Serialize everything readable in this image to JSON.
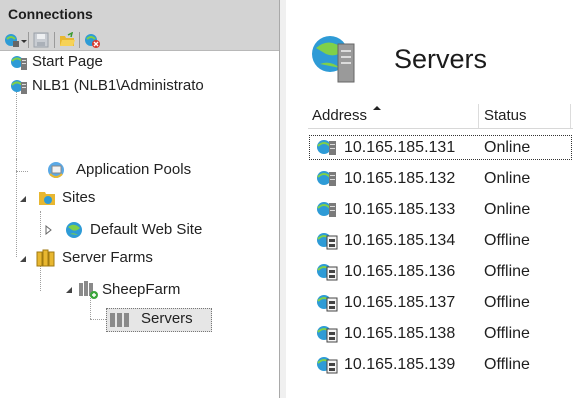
{
  "connections": {
    "title": "Connections",
    "toolbar": [
      "connect-icon",
      "save-icon",
      "open-folder-icon",
      "disconnect-icon"
    ]
  },
  "tree": {
    "start_page": "Start Page",
    "server": "NLB1 (NLB1\\Administrato",
    "app_pools": "Application Pools",
    "sites": "Sites",
    "default_site": "Default Web Site",
    "server_farms": "Server Farms",
    "farm": "SheepFarm",
    "servers": "Servers"
  },
  "main": {
    "title": "Servers",
    "columns": {
      "address": "Address",
      "status": "Status"
    },
    "rows": [
      {
        "address": "10.165.185.131",
        "status": "Online"
      },
      {
        "address": "10.165.185.132",
        "status": "Online"
      },
      {
        "address": "10.165.185.133",
        "status": "Online"
      },
      {
        "address": "10.165.185.134",
        "status": "Offline"
      },
      {
        "address": "10.165.185.136",
        "status": "Offline"
      },
      {
        "address": "10.165.185.137",
        "status": "Offline"
      },
      {
        "address": "10.165.185.138",
        "status": "Offline"
      },
      {
        "address": "10.165.185.139",
        "status": "Offline"
      }
    ]
  },
  "colors": {
    "header_bg": "#d3d3d3",
    "selected_bg": "#e6e6e6",
    "globe": "#2e9bd6",
    "server": "#8a8a8a"
  }
}
